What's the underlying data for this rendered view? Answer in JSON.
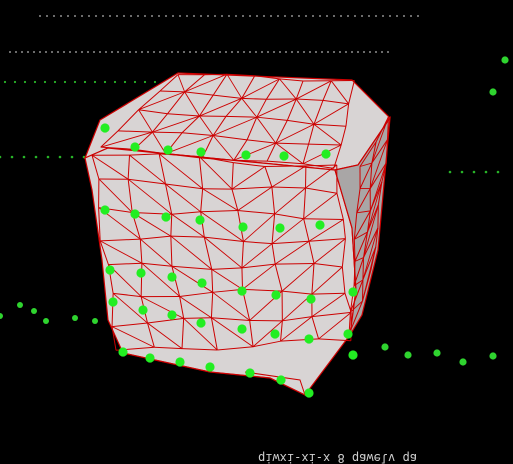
{
  "window": {
    "status_text": "qiwxi-xi-x  8 qawelv qa"
  },
  "scene": {
    "colors": {
      "background": "#000000",
      "mesh_fill": "#d8d4d4",
      "mesh_shadow": "#a9a6a6",
      "mesh_edge": "#cc0000",
      "points": "#22ee22",
      "point_trails": "#2fd42f",
      "dotted_rows": "#d8d8d8"
    },
    "icons": {
      "mesh": "deformed-cube-mesh",
      "points": "green-point-markers"
    }
  }
}
